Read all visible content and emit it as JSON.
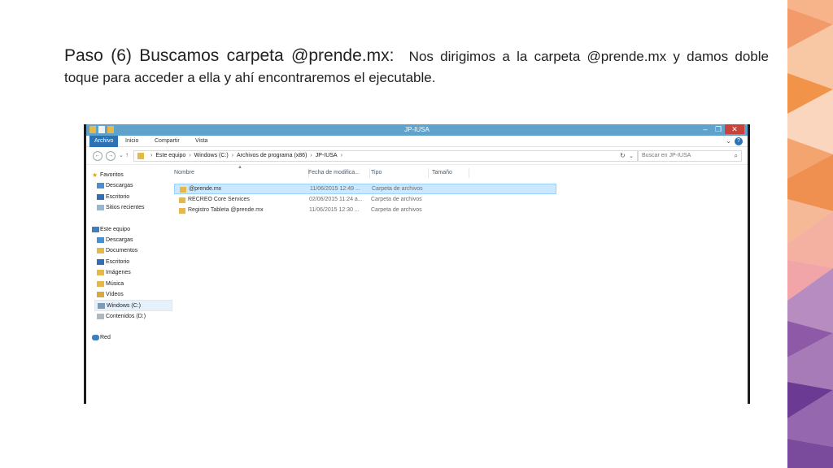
{
  "slide": {
    "heading": "Paso (6) Buscamos carpeta @prende.mx:",
    "body": "Nos dirigimos a la carpeta @prende.mx y damos doble toque para acceder a ella y ahí encontraremos el ejecutable."
  },
  "window": {
    "title": "JP-IUSA",
    "controls": {
      "minimize": "–",
      "maximize": "❐",
      "close": "✕"
    },
    "ribbon_tabs": [
      "Archivo",
      "Inicio",
      "Compartir",
      "Vista"
    ],
    "help": "?",
    "address": {
      "crumbs": [
        "Este equipo",
        "Windows (C:)",
        "Archivos de programa (x86)",
        "JP-IUSA"
      ],
      "separator": "›"
    },
    "search_placeholder": "Buscar en JP-IUSA",
    "nav": {
      "favorites_label": "Favoritos",
      "favorites": [
        "Descargas",
        "Escritorio",
        "Sitios recientes"
      ],
      "pc_label": "Este equipo",
      "pc_items": [
        "Descargas",
        "Documentos",
        "Escritorio",
        "Imágenes",
        "Música",
        "Vídeos",
        "Windows (C:)",
        "Contenidos (D:)"
      ],
      "network_label": "Red"
    },
    "columns": [
      "Nombre",
      "Fecha de modifica...",
      "Tipo",
      "Tamaño"
    ],
    "files": [
      {
        "name": "@prende.mx",
        "date": "11/06/2015 12:49 ...",
        "type": "Carpeta de archivos",
        "selected": true
      },
      {
        "name": "RECREO Core Services",
        "date": "02/06/2015 11:24 a...",
        "type": "Carpeta de archivos",
        "selected": false
      },
      {
        "name": "Registro Tableta @prende.mx",
        "date": "11/06/2015 12:30 ...",
        "type": "Carpeta de archivos",
        "selected": false
      }
    ]
  },
  "colors": {
    "titlebar": "#5fa3cc",
    "active_tab": "#2b73b7",
    "close": "#c9433a",
    "selection": "#cce8ff",
    "folder": "#e6b84a"
  }
}
